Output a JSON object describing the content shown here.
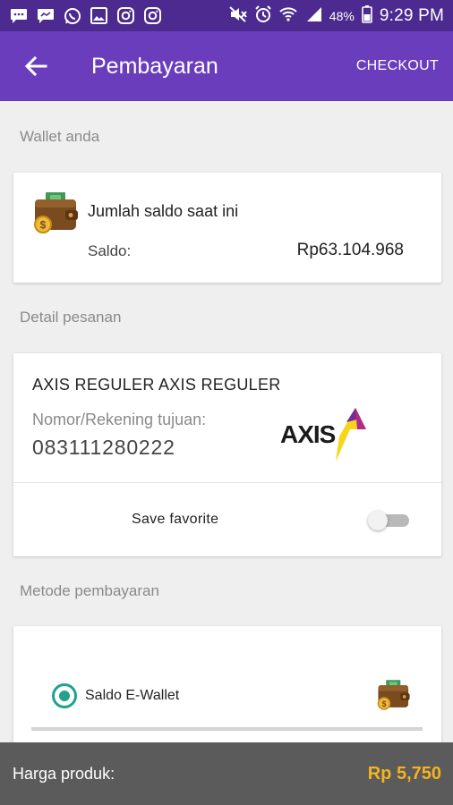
{
  "status_bar": {
    "battery": "48%",
    "time": "9:29 PM",
    "icons": [
      "messages-icon",
      "chat-icon",
      "whatsapp-icon",
      "gallery-icon",
      "instagram-icon",
      "instagram-icon",
      "mute-icon",
      "alarm-icon",
      "wifi-icon",
      "signal-icon",
      "battery-icon"
    ]
  },
  "app_bar": {
    "title": "Pembayaran",
    "action": "CHECKOUT"
  },
  "wallet_section": {
    "label": "Wallet anda",
    "balance_title": "Jumlah saldo saat ini",
    "balance_label": "Saldo:",
    "balance_value": "Rp63.104.968"
  },
  "detail_section": {
    "label": "Detail pesanan",
    "product_name": "AXIS REGULER AXIS REGULER",
    "destination_label": "Nomor/Rekening tujuan:",
    "destination_value": "083111280222",
    "operator_logo_text": "AXIS",
    "favorite_label": "Save  favorite",
    "favorite_enabled": false
  },
  "payment_section": {
    "label": "Metode pembayaran",
    "option_label": "Saldo E-Wallet",
    "option_selected": true
  },
  "bottom_bar": {
    "price_label": "Harga produk:",
    "price_value": "Rp 5,750"
  },
  "colors": {
    "status_bar": "#4d2a8f",
    "app_bar": "#6a3dbd",
    "radio_accent": "#1fa38b",
    "price_accent": "#f3b322",
    "bottom_bar": "#5b5b5b"
  }
}
